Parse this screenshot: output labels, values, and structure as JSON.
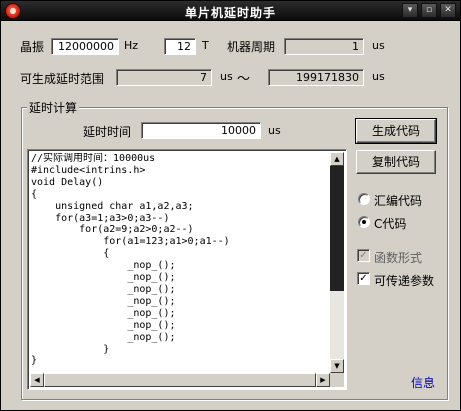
{
  "window": {
    "title": "单片机延时助手"
  },
  "titlebar_buttons": [
    {
      "name": "minimize",
      "glyph": "▾"
    },
    {
      "name": "maximize",
      "glyph": "▫"
    },
    {
      "name": "close",
      "glyph": "✕"
    }
  ],
  "crystal": {
    "label": "晶振",
    "value": "12000000",
    "unit": "Hz"
  },
  "cycle": {
    "t_value": "12",
    "t_unit": "T",
    "label": "机器周期",
    "value": "1",
    "unit": "us"
  },
  "range": {
    "label": "可生成延时范围",
    "min": "7",
    "min_unit": "us",
    "sep": "～",
    "max": "199171830",
    "max_unit": "us"
  },
  "group": {
    "title": "延时计算"
  },
  "delay": {
    "label": "延时时间",
    "value": "10000",
    "unit": "us"
  },
  "buttons": {
    "generate": "生成代码",
    "copy": "复制代码"
  },
  "language": {
    "asm_label": "汇编代码",
    "c_label": "C代码",
    "selected": "C代码"
  },
  "options": {
    "function_form": "函数形式",
    "function_form_checked": true,
    "function_form_enabled": false,
    "pass_params": "可传递参数",
    "pass_params_checked": true
  },
  "code": "//实际调用时间：10000us\n#include<intrins.h>\nvoid Delay()\n{\n    unsigned char a1,a2,a3;\n    for(a3=1;a3>0;a3--)\n        for(a2=9;a2>0;a2--)\n            for(a1=123;a1>0;a1--)\n            {\n                _nop_();\n                _nop_();\n                _nop_();\n                _nop_();\n                _nop_();\n                _nop_();\n                _nop_();\n            }\n}",
  "info_link": "信息",
  "colors": {
    "face": "#d4d0c8",
    "titlebar": "#141414",
    "link": "#0000c0"
  }
}
